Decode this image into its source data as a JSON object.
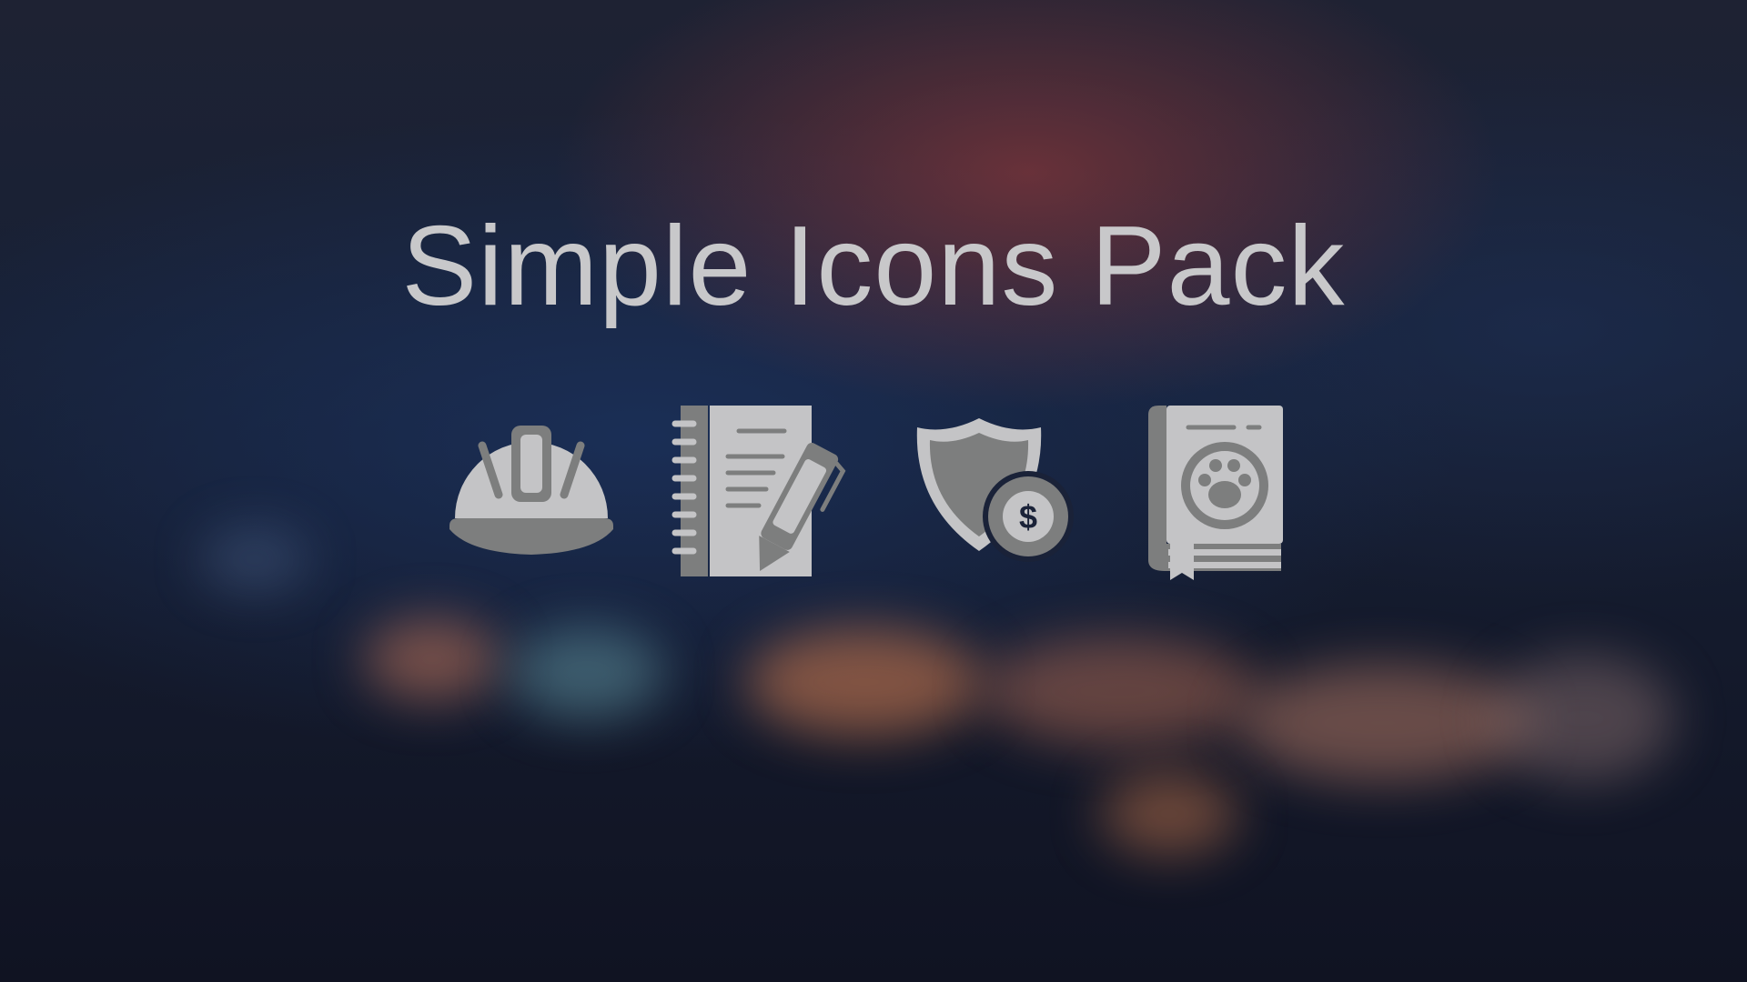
{
  "title": "Simple Icons Pack",
  "icons": [
    {
      "name": "hard-hat-icon"
    },
    {
      "name": "notebook-pen-icon"
    },
    {
      "name": "shield-dollar-icon"
    },
    {
      "name": "pet-book-icon"
    }
  ],
  "colors": {
    "icon_light": "#c4c4c6",
    "icon_dark": "#7d7e7e",
    "title": "#c8c8ca",
    "background_top": "#1e2233",
    "background_bottom": "#101322"
  }
}
